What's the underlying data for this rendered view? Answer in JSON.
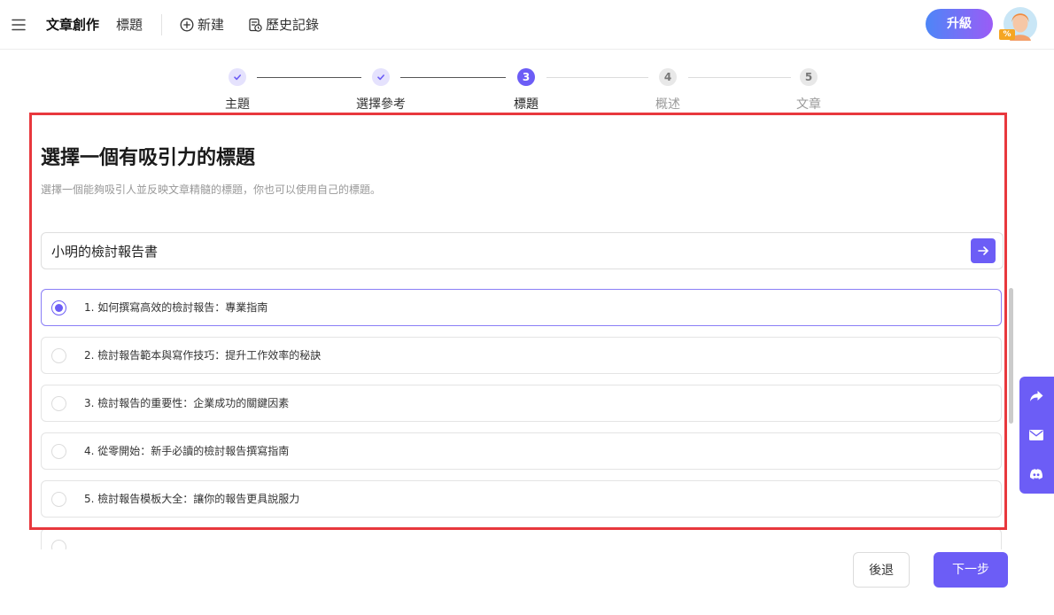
{
  "header": {
    "app_title": "文章創作",
    "section_title": "標題",
    "new_label": "新建",
    "history_label": "歷史記錄",
    "upgrade_label": "升級",
    "icons": {
      "menu": "hamburger-icon",
      "new": "plus-circle-icon",
      "history": "history-icon",
      "avatar_badge": "percent-badge-icon"
    },
    "avatar_badge_glyph": "%"
  },
  "stepper": {
    "steps": [
      {
        "label": "主題",
        "status": "done"
      },
      {
        "label": "選擇參考",
        "status": "done"
      },
      {
        "label": "標題",
        "number": "3",
        "status": "current"
      },
      {
        "label": "概述",
        "number": "4",
        "status": "pending"
      },
      {
        "label": "文章",
        "number": "5",
        "status": "pending"
      }
    ]
  },
  "main": {
    "title": "選擇一個有吸引力的標題",
    "subtitle": "選擇一個能夠吸引人並反映文章精髓的標題，你也可以使用自己的標題。",
    "input_value": "小明的檢討報告書",
    "selected_index": 0,
    "options": [
      "1. 如何撰寫高效的檢討報告：專業指南",
      "2. 檢討報告範本與寫作技巧：提升工作效率的秘訣",
      "3. 檢討報告的重要性：企業成功的關鍵因素",
      "4. 從零開始：新手必讀的檢討報告撰寫指南",
      "5. 檢討報告模板大全：讓你的報告更具說服力"
    ]
  },
  "side_panel": {
    "icons": [
      "share-icon",
      "mail-icon",
      "discord-icon"
    ]
  },
  "footer": {
    "back_label": "後退",
    "next_label": "下一步"
  },
  "colors": {
    "accent": "#6c5df6",
    "highlight": "#e8383d",
    "upgrade_gradient_start": "#4d86f7",
    "upgrade_gradient_end": "#9b5cf6"
  }
}
